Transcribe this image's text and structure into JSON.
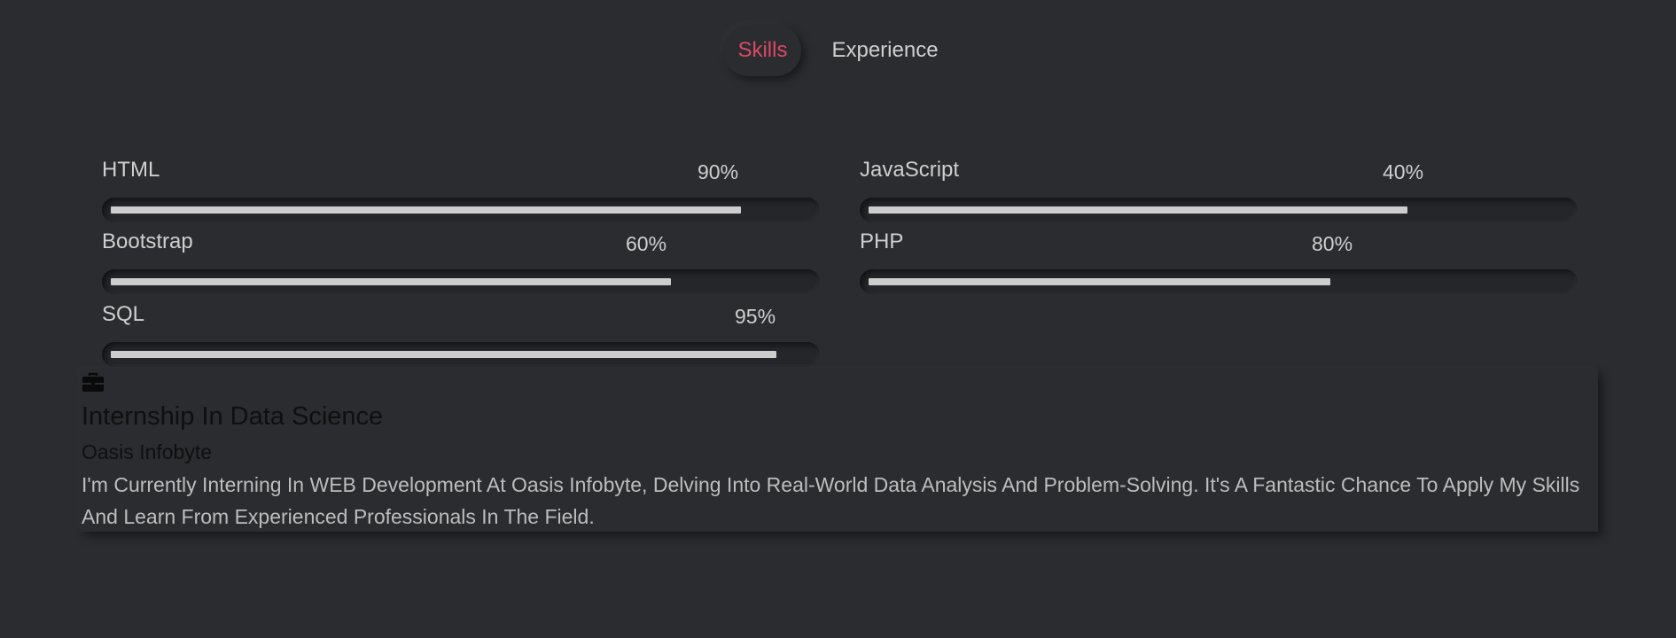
{
  "tabs": [
    {
      "label": "Skills",
      "active": true
    },
    {
      "label": "Experience",
      "active": false
    }
  ],
  "skills": [
    {
      "name": "HTML",
      "percent_label": "90%",
      "level": 0.9
    },
    {
      "name": "JavaScript",
      "percent_label": "40%",
      "level": 0.77
    },
    {
      "name": "Bootstrap",
      "percent_label": "60%",
      "level": 0.8
    },
    {
      "name": "PHP",
      "percent_label": "80%",
      "level": 0.66
    },
    {
      "name": "SQL",
      "percent_label": "95%",
      "level": 0.95
    }
  ],
  "experience": {
    "icon": "briefcase-icon",
    "title": "Internship In Data Science",
    "company": "Oasis Infobyte",
    "description": "I'm Currently Interning In WEB Development At Oasis Infobyte, Delving Into Real-World Data Analysis And Problem-Solving. It's A Fantastic Chance To Apply My Skills And Learn From Experienced Professionals In The Field."
  },
  "colors": {
    "background": "#2b2c30",
    "accent": "#d84a64",
    "text": "#cfcfcf",
    "bar_fill": "#cdcdcd"
  }
}
